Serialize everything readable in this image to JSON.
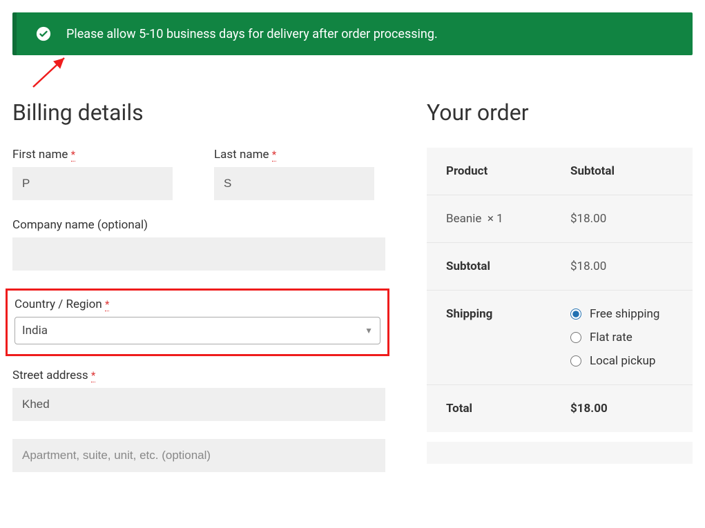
{
  "notice": {
    "message": "Please allow 5-10 business days for delivery after order processing."
  },
  "billing": {
    "heading": "Billing details",
    "first_name": {
      "label": "First name",
      "required": "*",
      "value": "P"
    },
    "last_name": {
      "label": "Last name",
      "required": "*",
      "value": "S"
    },
    "company": {
      "label": "Company name (optional)",
      "value": ""
    },
    "country": {
      "label": "Country / Region",
      "required": "*",
      "value": "India"
    },
    "street": {
      "label": "Street address",
      "required": "*",
      "value": "Khed"
    },
    "apt": {
      "placeholder": "Apartment, suite, unit, etc. (optional)",
      "value": ""
    }
  },
  "order": {
    "heading": "Your order",
    "head_product": "Product",
    "head_subtotal": "Subtotal",
    "item": {
      "name": "Beanie",
      "qty": "× 1",
      "price": "$18.00"
    },
    "subtotal": {
      "label": "Subtotal",
      "value": "$18.00"
    },
    "shipping": {
      "label": "Shipping",
      "options": {
        "free": "Free shipping",
        "flat": "Flat rate",
        "local": "Local pickup"
      },
      "selected": "free"
    },
    "total": {
      "label": "Total",
      "value": "$18.00"
    }
  }
}
